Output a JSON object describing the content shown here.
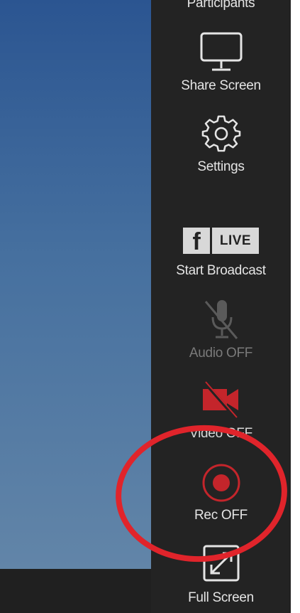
{
  "sidebar": {
    "items": [
      {
        "label": "Participants",
        "icon": "participants-icon"
      },
      {
        "label": "Share Screen",
        "icon": "monitor-icon"
      },
      {
        "label": "Settings",
        "icon": "gear-icon"
      },
      {
        "label": "Start Broadcast",
        "icon": "facebook-live-icon",
        "badge_letter": "f",
        "badge_text": "LIVE"
      },
      {
        "label": "Audio OFF",
        "icon": "microphone-muted-icon"
      },
      {
        "label": "Video OFF",
        "icon": "video-camera-off-icon"
      },
      {
        "label": "Rec OFF",
        "icon": "record-icon"
      },
      {
        "label": "Full Screen",
        "icon": "fullscreen-icon"
      }
    ]
  },
  "colors": {
    "sidebar_bg": "#232323",
    "video_gradient_top": "#2b5591",
    "video_gradient_bottom": "#6285a8",
    "highlight": "#e0242b",
    "muted_red": "#c4252b"
  }
}
